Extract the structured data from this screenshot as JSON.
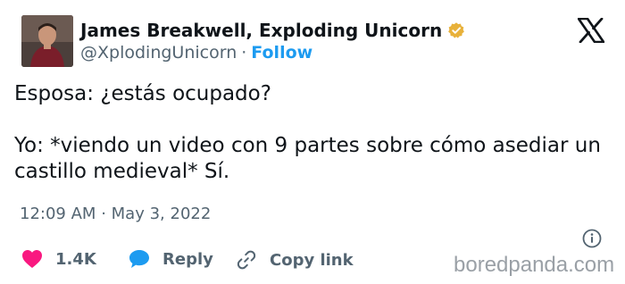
{
  "author": {
    "name": "James Breakwell, Exploding Unicorn",
    "handle": "@XplodingUnicorn",
    "separator": "·",
    "follow_label": "Follow",
    "verified_badge_color": "#e8b13a"
  },
  "tweet": {
    "lines": [
      "Esposa: ¿estás ocupado?",
      "Yo: *viendo un video con 9 partes sobre cómo asediar un castillo medieval* Sí."
    ],
    "time": "12:09 AM",
    "date_separator": "·",
    "date": "May 3, 2022"
  },
  "actions": {
    "like_count": "1.4K",
    "reply_label": "Reply",
    "copy_link_label": "Copy link"
  },
  "watermark": "boredpanda.com",
  "icons": [
    "avatar",
    "verified-badge-icon",
    "x-logo-icon",
    "info-icon",
    "heart-icon",
    "reply-bubble-icon",
    "link-icon"
  ],
  "colors": {
    "accent": "#1d9bf0",
    "heart": "#f91880",
    "muted": "#536471",
    "text": "#0f1419"
  }
}
